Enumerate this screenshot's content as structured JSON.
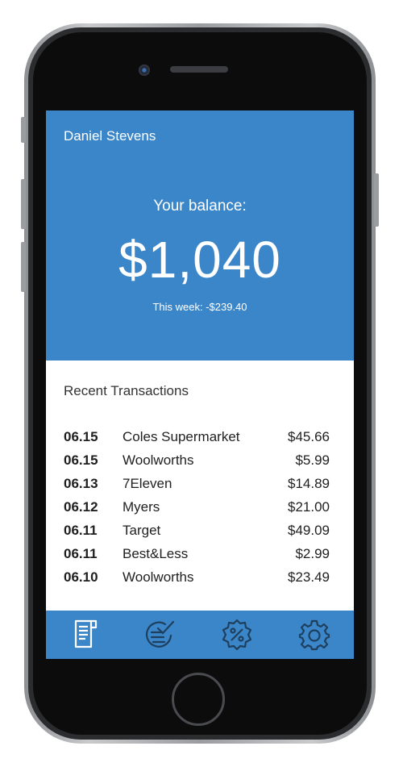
{
  "user": {
    "name": "Daniel Stevens"
  },
  "balance": {
    "label": "Your balance:",
    "amount": "$1,040",
    "week_change": "This week: -$239.40"
  },
  "transactions": {
    "title": "Recent Transactions",
    "rows": [
      {
        "date": "06.15",
        "merchant": "Coles Supermarket",
        "amount": "$45.66"
      },
      {
        "date": "06.15",
        "merchant": "Woolworths",
        "amount": "$5.99"
      },
      {
        "date": "06.13",
        "merchant": "7Eleven",
        "amount": "$14.89"
      },
      {
        "date": "06.12",
        "merchant": "Myers",
        "amount": "$21.00"
      },
      {
        "date": "06.11",
        "merchant": "Target",
        "amount": "$49.09"
      },
      {
        "date": "06.11",
        "merchant": "Best&Less",
        "amount": "$2.99"
      },
      {
        "date": "06.10",
        "merchant": "Woolworths",
        "amount": "$23.49"
      }
    ]
  },
  "tab_bar": {
    "tabs": [
      {
        "icon": "receipt-icon",
        "active": true
      },
      {
        "icon": "checklist-icon",
        "active": false
      },
      {
        "icon": "discount-badge-icon",
        "active": false
      },
      {
        "icon": "gear-icon",
        "active": false
      }
    ]
  },
  "colors": {
    "accent": "#3b86c8",
    "active_icon": "#ffffff",
    "inactive_icon": "#1e3f5e"
  }
}
